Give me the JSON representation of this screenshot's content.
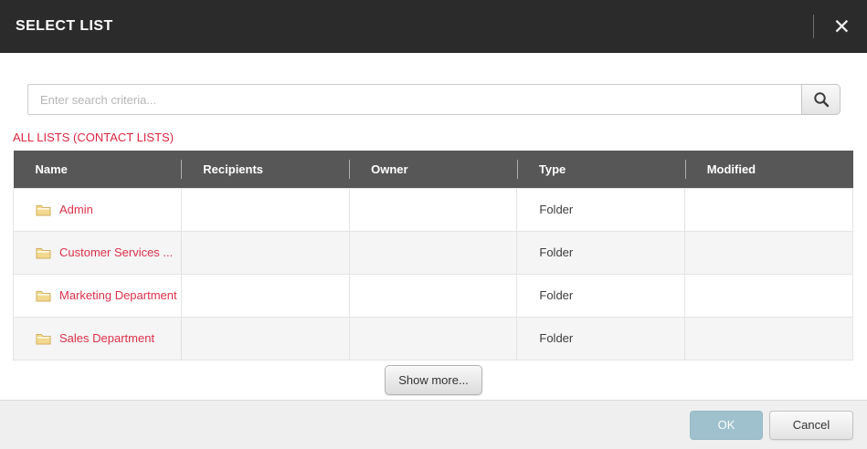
{
  "dialog": {
    "title": "SELECT LIST",
    "close_icon": "x-close-icon"
  },
  "search": {
    "placeholder": "Enter search criteria...",
    "value": "",
    "button_icon": "magnifier-icon"
  },
  "section_label": "ALL LISTS (CONTACT LISTS)",
  "table": {
    "columns": [
      "Name",
      "Recipients",
      "Owner",
      "Type",
      "Modified"
    ],
    "rows": [
      {
        "icon": "folder-icon",
        "name": "Admin",
        "recipients": "",
        "owner": "",
        "type": "Folder",
        "modified": ""
      },
      {
        "icon": "folder-icon",
        "name": "Customer Services ...",
        "recipients": "",
        "owner": "",
        "type": "Folder",
        "modified": ""
      },
      {
        "icon": "folder-icon",
        "name": "Marketing Department",
        "recipients": "",
        "owner": "",
        "type": "Folder",
        "modified": ""
      },
      {
        "icon": "folder-icon",
        "name": "Sales Department",
        "recipients": "",
        "owner": "",
        "type": "Folder",
        "modified": ""
      }
    ]
  },
  "show_more_label": "Show more...",
  "footer": {
    "ok_label": "OK",
    "cancel_label": "Cancel"
  },
  "colors": {
    "header_bg": "#2b2b2b",
    "table_header_bg": "#575757",
    "accent_red": "#dc3049",
    "ok_button_bg": "#9ec1cd",
    "footer_bg": "#efefef",
    "row_stripe": "#f5f5f5",
    "folder_fill": "#f3d98f"
  }
}
